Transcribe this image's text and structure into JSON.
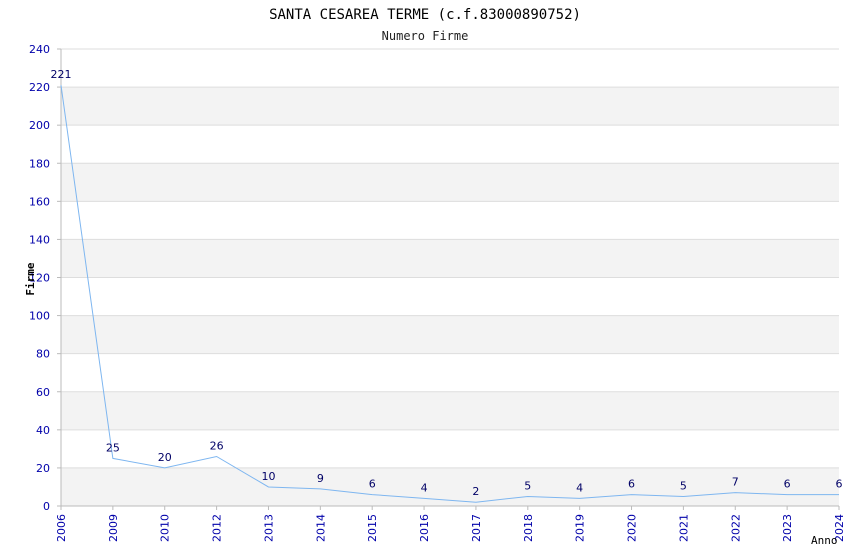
{
  "chart_data": {
    "type": "line",
    "title": "SANTA CESAREA TERME (c.f.83000890752)",
    "subtitle": "Numero Firme",
    "xlabel": "Anno",
    "ylabel": "Firme",
    "categories": [
      "2006",
      "2009",
      "2010",
      "2012",
      "2013",
      "2014",
      "2015",
      "2016",
      "2017",
      "2018",
      "2019",
      "2020",
      "2021",
      "2022",
      "2023",
      "2024"
    ],
    "series": [
      {
        "values": [
          221,
          25,
          20,
          26,
          10,
          9,
          6,
          4,
          2,
          5,
          4,
          6,
          5,
          7,
          6,
          6
        ]
      }
    ],
    "ylim": [
      0,
      240
    ],
    "yticks": [
      0,
      20,
      40,
      60,
      80,
      100,
      120,
      140,
      160,
      180,
      200,
      220,
      240
    ],
    "grid": true,
    "colors": {
      "line": "#7eb6f0",
      "tick_label": "#0000aa",
      "data_label": "#000066",
      "band": "#f3f3f3",
      "grid": "#dddddd",
      "axis": "#bbbbbb",
      "title": "#000000"
    }
  }
}
